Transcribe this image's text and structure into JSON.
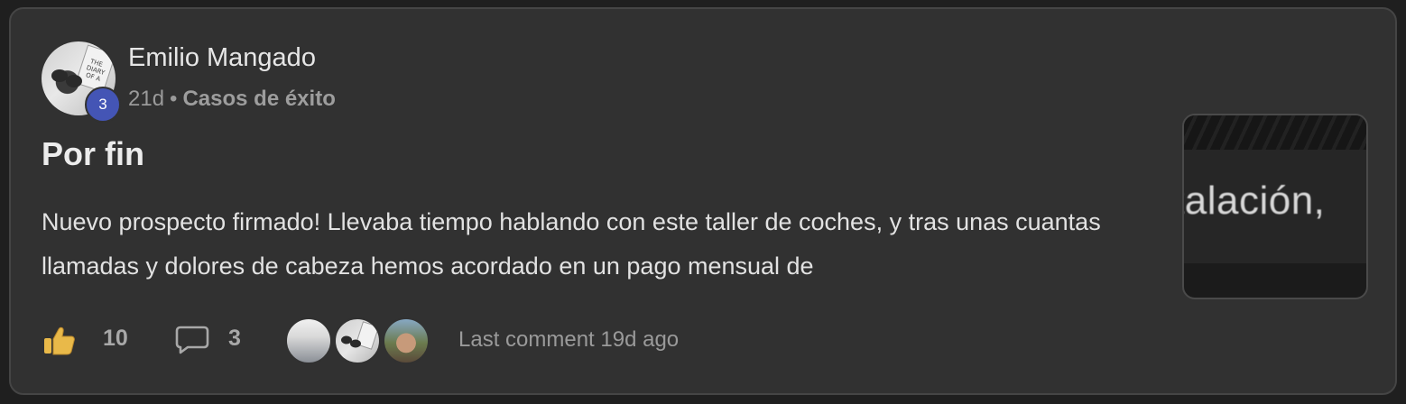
{
  "post": {
    "author_name": "Emilio Mangado",
    "author_level": "3",
    "age": "21d",
    "separator": "•",
    "category": "Casos de éxito",
    "title": "Por fin",
    "body": "Nuevo prospecto firmado! Llevaba tiempo hablando con este taller de coches, y tras unas cuantas llamadas y dolores de cabeza hemos acordado en un pago mensual de",
    "thumbnail_text": "talación,"
  },
  "footer": {
    "like_count": "10",
    "comment_count": "3",
    "last_comment": "Last comment 19d ago"
  },
  "icons": {
    "like": "thumbs-up-icon",
    "comment": "comment-bubble-icon"
  },
  "colors": {
    "card_bg": "#313131",
    "badge_bg": "#4455b5",
    "like_icon": "#e9b949"
  }
}
